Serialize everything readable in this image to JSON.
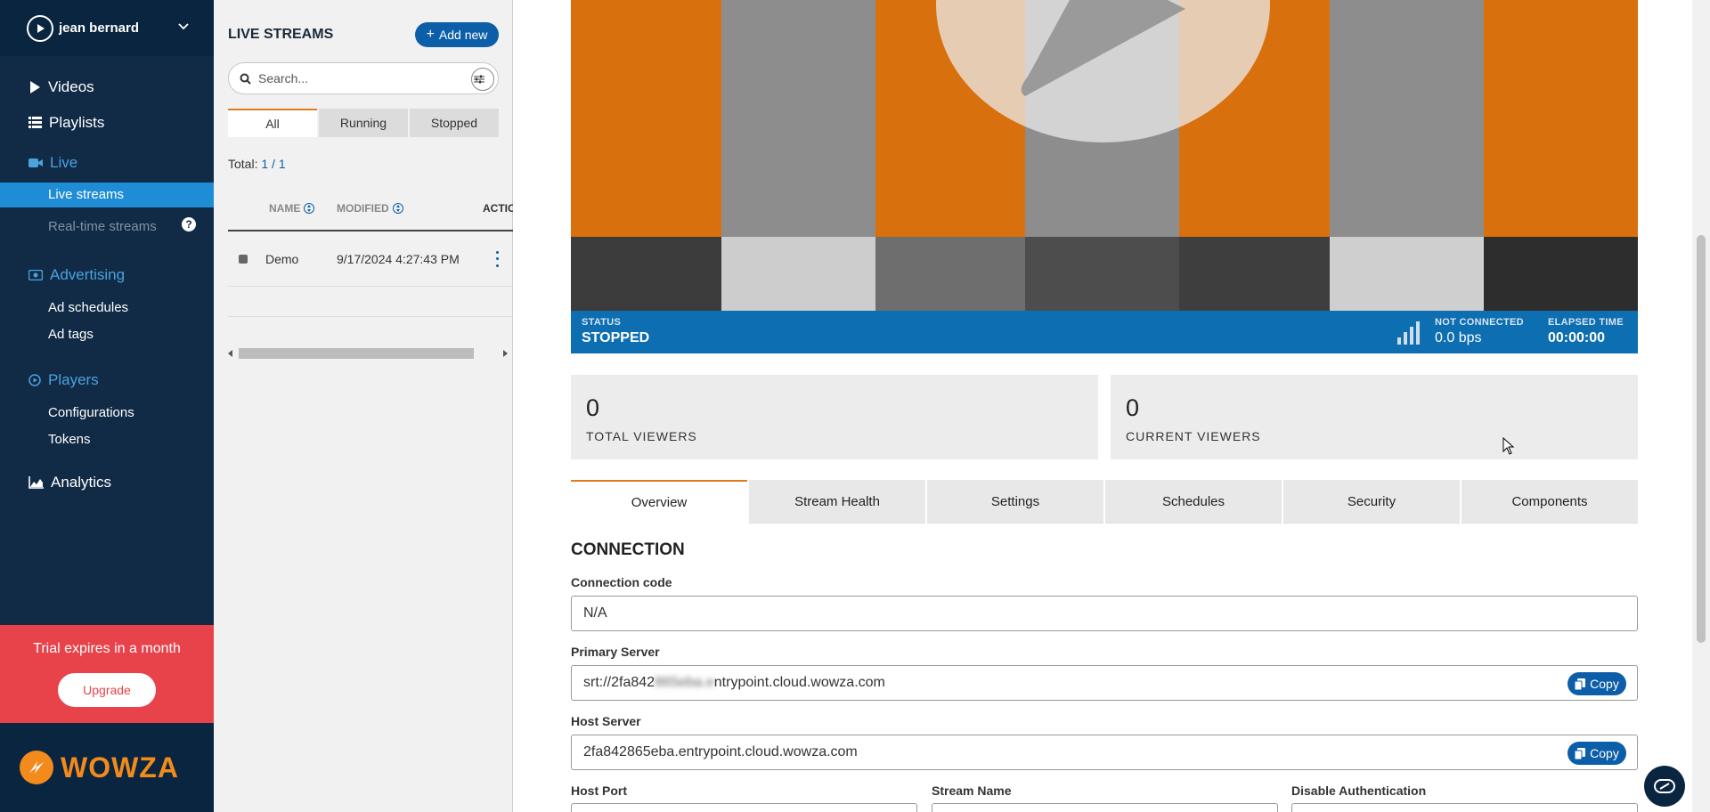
{
  "sidebar": {
    "user_name": "jean bernard",
    "nav": {
      "videos": "Videos",
      "playlists": "Playlists",
      "live": "Live",
      "live_streams": "Live streams",
      "realtime_streams": "Real-time streams",
      "help": "?",
      "advertising": "Advertising",
      "ad_schedules": "Ad schedules",
      "ad_tags": "Ad tags",
      "players": "Players",
      "configurations": "Configurations",
      "tokens": "Tokens",
      "analytics": "Analytics"
    },
    "trial_text": "Trial expires in a month",
    "upgrade_label": "Upgrade",
    "logo_text": "WOWZA"
  },
  "list": {
    "title": "LIVE STREAMS",
    "add_new_label": "Add new",
    "search_placeholder": "Search...",
    "tabs": [
      "All",
      "Running",
      "Stopped"
    ],
    "total_label": "Total:",
    "total_value": "1 / 1",
    "columns": {
      "name": "NAME",
      "modified": "MODIFIED",
      "actions": "ACTIC"
    },
    "rows": [
      {
        "name": "Demo",
        "modified": "9/17/2024 4:27:43 PM"
      }
    ]
  },
  "status": {
    "status_label": "STATUS",
    "status_value": "STOPPED",
    "connection_label": "NOT CONNECTED",
    "connection_value": "0.0 bps",
    "elapsed_label": "ELAPSED TIME",
    "elapsed_value": "00:00:00"
  },
  "stats": {
    "total_viewers": {
      "value": "0",
      "label": "TOTAL VIEWERS"
    },
    "current_viewers": {
      "value": "0",
      "label": "CURRENT VIEWERS"
    }
  },
  "tabs": [
    "Overview",
    "Stream Health",
    "Settings",
    "Schedules",
    "Security",
    "Components"
  ],
  "connection": {
    "title": "CONNECTION",
    "connection_code_label": "Connection code",
    "connection_code_value": "N/A",
    "primary_server_label": "Primary Server",
    "primary_server_prefix": "srt://2fa842",
    "primary_server_hidden": "865eba.e",
    "primary_server_suffix": "ntrypoint.cloud.wowza.com",
    "host_server_label": "Host Server",
    "host_server_value": "2fa842865eba.entrypoint.cloud.wowza.com",
    "copy_label": "Copy",
    "host_port_label": "Host Port",
    "stream_name_label": "Stream Name",
    "disable_auth_label": "Disable Authentication"
  },
  "colors": {
    "sidebar_bg": "#112b47",
    "accent_blue": "#0d5ea8",
    "status_blue": "#0d6eb1",
    "accent_orange": "#e07a1f",
    "trial_red": "#e8424b",
    "logo_orange": "#f28a1c"
  },
  "icons": {
    "user": "play-circle-icon",
    "chevron": "chevron-down-icon",
    "search": "search-icon",
    "filter": "filter-sliders-icon",
    "signal": "signal-bars-icon",
    "copy": "copy-icon",
    "chat": "chat-icon"
  }
}
